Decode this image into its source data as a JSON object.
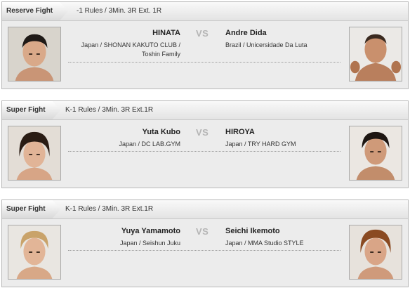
{
  "bouts": [
    {
      "label": "Reserve Fight",
      "rules": "-1 Rules / 3Min. 3R Ext. 1R",
      "vs": "VS",
      "left": {
        "name": "HINATA",
        "affiliation_line1": "Japan / SHONAN KAKUTO CLUB /",
        "affiliation_line2": "Toshin Family"
      },
      "right": {
        "name": "Andre Dida",
        "affiliation_line1": "Brazil / Unicersidade Da Luta"
      }
    },
    {
      "label": "Super Fight",
      "rules": "K-1 Rules / 3Min. 3R Ext.1R",
      "vs": "VS",
      "left": {
        "name": "Yuta Kubo",
        "affiliation_line1": "Japan / DC LAB.GYM"
      },
      "right": {
        "name": "HIROYA",
        "affiliation_line1": "Japan / TRY HARD GYM"
      }
    },
    {
      "label": "Super Fight",
      "rules": "K-1 Rules / 3Min. 3R Ext.1R",
      "vs": "VS",
      "left": {
        "name": "Yuya Yamamoto",
        "affiliation_line1": "Japan / Seishun Juku"
      },
      "right": {
        "name": "Seichi Ikemoto",
        "affiliation_line1": "Japan / MMA Studio STYLE"
      }
    }
  ],
  "colors": {
    "vs_text": "#b5b5b5",
    "panel_bg": "#ececec",
    "border": "#b9b9b9"
  }
}
